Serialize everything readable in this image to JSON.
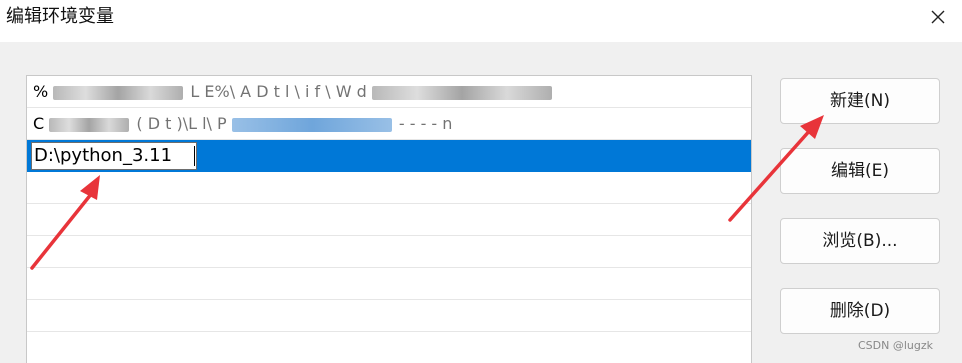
{
  "window": {
    "title": "编辑环境变量",
    "close_label": "✕"
  },
  "path_list": {
    "rows": [
      {
        "text_visible_start": "%",
        "text_visible_mid": "L E%\\ A  D  t    l  \\  i     f  \\ W  d",
        "state": "obscured"
      },
      {
        "text_visible_start": "C",
        "text_visible_mid": "(     D t )\\L   l\\ P",
        "text_visible_end": "-  -  -  -  n",
        "state": "obscured"
      }
    ],
    "editing_value": "D:\\python_3.11"
  },
  "buttons": {
    "new": "新建(N)",
    "edit": "编辑(E)",
    "browse": "浏览(B)...",
    "delete": "删除(D)"
  },
  "watermark": "CSDN @lugzk",
  "colors": {
    "selection": "#0078d7",
    "annotation_arrow": "#e8343a"
  }
}
